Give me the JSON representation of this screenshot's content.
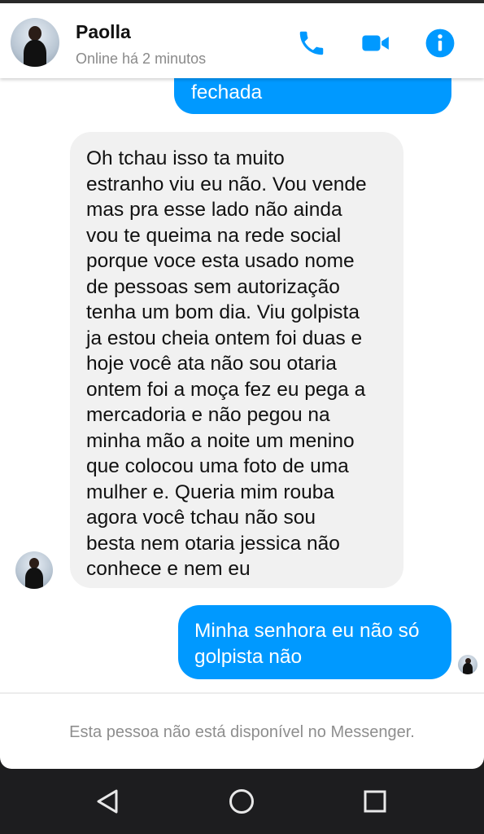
{
  "header": {
    "contact_name": "Paolla",
    "status": "Online há 2 minutos",
    "icons": [
      "avatar",
      "phone-icon",
      "video-camera-icon",
      "info-icon"
    ],
    "accent_color": "#0099ff"
  },
  "messages": [
    {
      "direction": "outgoing",
      "text": "fechada"
    },
    {
      "direction": "incoming",
      "text": "Oh tchau isso ta muito\nestranho viu eu não. Vou vende\nmas pra esse lado não ainda\nvou te queima na rede social\nporque voce esta usado nome\nde pessoas sem autorização\ntenha um bom dia. Viu golpista\nja estou cheia ontem foi duas e\nhoje você ata não sou otaria\nontem foi a moça fez eu pega a\nmercadoria e não pegou na\nminha mão a noite um menino\nque colocou uma foto de uma\nmulher e. Queria mim rouba\nagora você tchau não sou\nbesta nem otaria jessica não\nconhece e nem eu"
    },
    {
      "direction": "outgoing",
      "text": "Minha senhora eu não só\ngolpista não"
    }
  ],
  "footer": {
    "notice": "Esta pessoa não está disponível no Messenger."
  },
  "colors": {
    "outgoing_bubble": "#0099ff",
    "incoming_bubble": "#f1f1f1"
  },
  "navbar": {
    "icons": [
      "back-triangle-icon",
      "home-circle-icon",
      "recents-square-icon"
    ]
  }
}
